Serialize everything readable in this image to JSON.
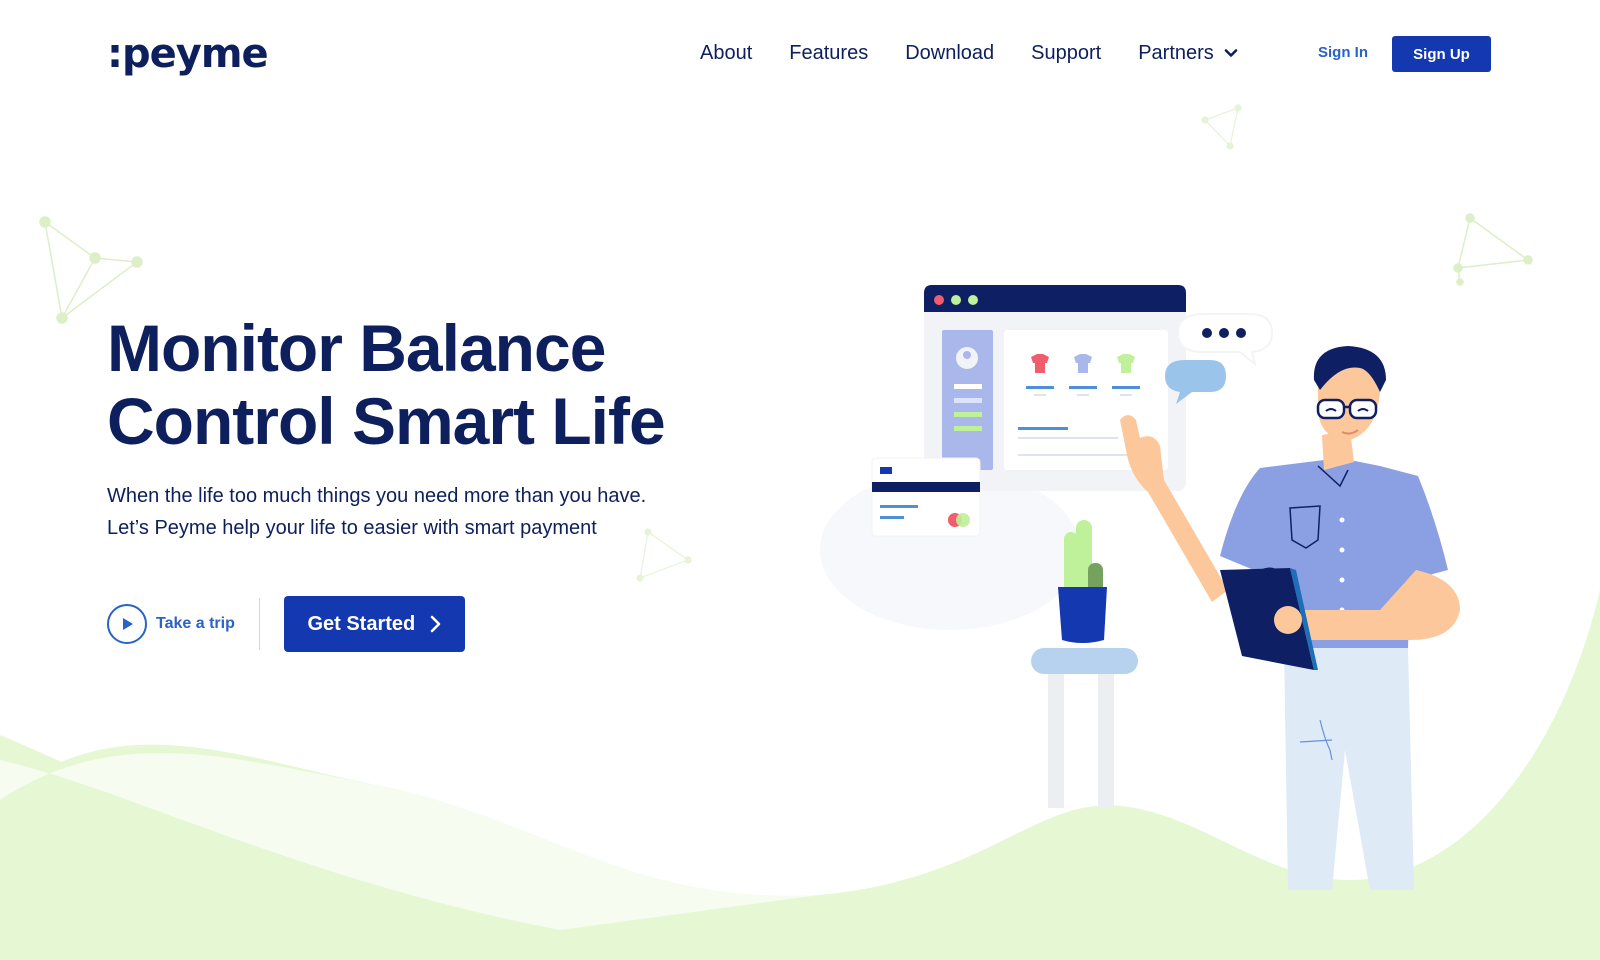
{
  "brand": {
    "logo_text": ":peyme"
  },
  "nav": {
    "links": [
      {
        "label": "About"
      },
      {
        "label": "Features"
      },
      {
        "label": "Download"
      },
      {
        "label": "Support"
      },
      {
        "label": "Partners",
        "has_dropdown": true,
        "icon": "chevron-down-icon"
      }
    ],
    "sign_in": "Sign In",
    "sign_up": "Sign Up"
  },
  "hero": {
    "title_line1": "Monitor Balance",
    "title_line2": "Control Smart Life",
    "subtitle_line1": "When the life too much things you need more than you have.",
    "subtitle_line2": "Let’s Peyme help your life to easier with smart payment"
  },
  "cta": {
    "trip_label": "Take a trip",
    "trip_icon": "play-icon",
    "get_started_label": "Get Started",
    "get_started_icon": "chevron-right-icon"
  },
  "colors": {
    "primary": "#1338b0",
    "navy": "#0d1f5c",
    "link_blue": "#2a62c6",
    "wave_green": "#e5f7d3",
    "shirt_blue": "#8b9fe3"
  }
}
